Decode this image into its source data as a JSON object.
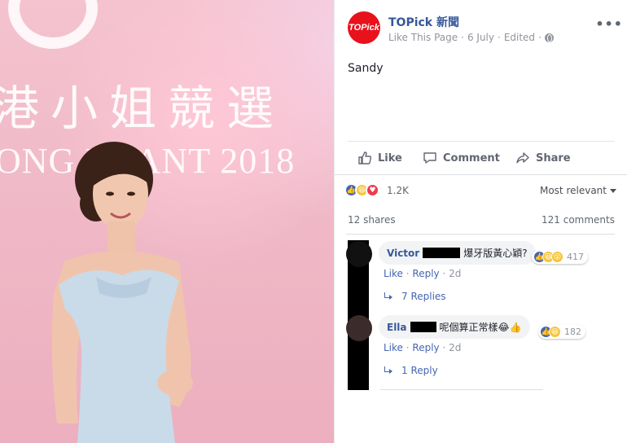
{
  "photo": {
    "backdrop_cn": "港小姐競選",
    "backdrop_en": "ONG PA    ANT 2018",
    "subject": "woman in pale blue off-shoulder dress"
  },
  "post": {
    "page_name": "TOPick 新聞",
    "avatar_text": "TOPick",
    "like_this_page": "Like This Page",
    "date": "6 July",
    "edited": "Edited",
    "separator": "·",
    "more": "•••",
    "text": "Sandy"
  },
  "actions": {
    "like": "Like",
    "comment": "Comment",
    "share": "Share"
  },
  "reactions": {
    "count": "1.2K",
    "sort_label": "Most relevant"
  },
  "stats": {
    "shares": "12 shares",
    "comments": "121 comments"
  },
  "comments": [
    {
      "name": "Victor",
      "text": "爆牙版黃心穎?",
      "reaction_count": "417",
      "like": "Like",
      "reply": "Reply",
      "age": "2d",
      "replies": "7 Replies"
    },
    {
      "name": "Ella",
      "text": "呢個算正常樣😂👍",
      "reaction_count": "182",
      "like": "Like",
      "reply": "Reply",
      "age": "2d",
      "replies": "1 Reply"
    }
  ],
  "colors": {
    "link": "#365899",
    "like_blue": "#4267b2",
    "love_red": "#f0394f",
    "haha_yellow": "#f7c43a",
    "brand_red": "#e8121c"
  }
}
